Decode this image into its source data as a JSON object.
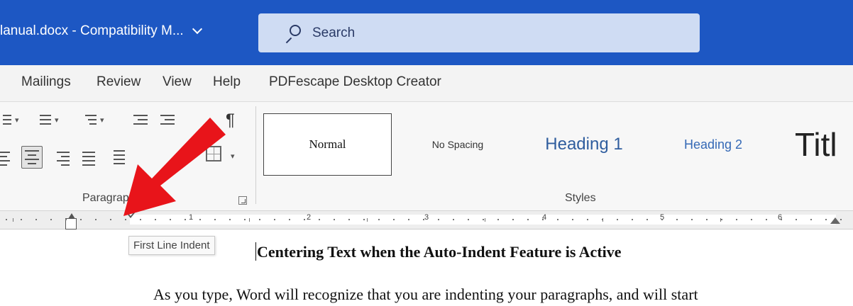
{
  "window": {
    "doc_title": "lanual.docx  -  Compatibility M...",
    "search": {
      "placeholder": "Search"
    },
    "colors": {
      "titlebar": "#1d57c3",
      "search_bg": "#cfdcf3",
      "arrow": "#e8141a"
    }
  },
  "tabs": [
    "Mailings",
    "Review",
    "View",
    "Help",
    "PDFescape Desktop Creator"
  ],
  "ribbon": {
    "paragraph_label": "Paragraph",
    "styles_label": "Styles",
    "paragraph_icons": [
      "bullets-icon",
      "numbering-icon",
      "multilevel-list-icon",
      "decrease-indent-icon",
      "increase-indent-icon",
      "show-hide-marks-icon",
      "align-left-icon",
      "align-center-icon",
      "align-right-icon",
      "justify-icon",
      "line-spacing-icon",
      "borders-icon"
    ],
    "styles": [
      "Normal",
      "No Spacing",
      "Heading 1",
      "Heading 2",
      "Titl"
    ],
    "selected_style": "Normal"
  },
  "ruler": {
    "numbers": [
      "1",
      "2",
      "3",
      "4",
      "5",
      "6"
    ]
  },
  "annotation": {
    "tooltip": "First Line Indent"
  },
  "document": {
    "heading": "Centering Text when the Auto-Indent Feature is Active",
    "body": "As you type, Word will recognize that you are indenting your paragraphs, and will start"
  }
}
